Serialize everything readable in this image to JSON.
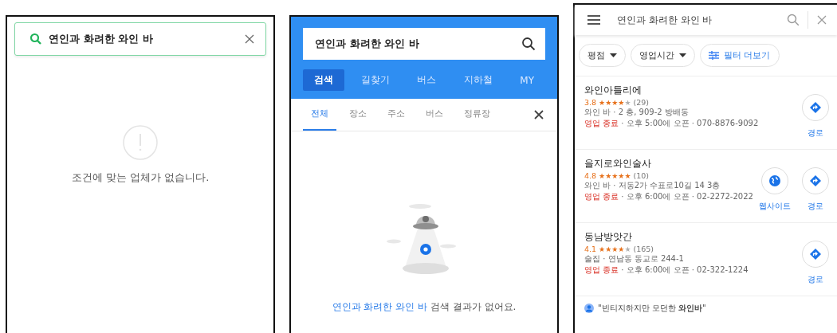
{
  "empty_result_screen": {
    "search": {
      "value": "연인과 화려한 와인 바"
    },
    "message": "조건에 맞는 업체가 없습니다."
  },
  "map_search_screen": {
    "search": {
      "value": "연인과 화려한 와인 바"
    },
    "main_tabs": [
      {
        "label": "검색",
        "selected": true
      },
      {
        "label": "길찾기",
        "selected": false
      },
      {
        "label": "버스",
        "selected": false
      },
      {
        "label": "지하철",
        "selected": false
      },
      {
        "label": "MY",
        "selected": false
      }
    ],
    "result_tabs": [
      {
        "label": "전체",
        "selected": true
      },
      {
        "label": "장소",
        "selected": false
      },
      {
        "label": "주소",
        "selected": false
      },
      {
        "label": "버스",
        "selected": false
      },
      {
        "label": "정류장",
        "selected": false
      }
    ],
    "no_result": {
      "query": "연인과 화려한 와인 바",
      "message": " 검색 결과가 없어요."
    }
  },
  "place_list_screen": {
    "search": {
      "value": "연인과 화려한 와인 바"
    },
    "filters": [
      {
        "kind": "dropdown",
        "label": "평점"
      },
      {
        "kind": "dropdown",
        "label": "영업시간"
      },
      {
        "kind": "more",
        "label": "필터 더보기"
      }
    ],
    "places": [
      {
        "name": "와인아틀리에",
        "rating": "3.8",
        "stars": 4,
        "reviews": "(29)",
        "details": "와인 바 · 2 층, 909-2 방배동",
        "status": "영업 종료",
        "hours": " · 오후 5:00에 오픈 · 070-8876-9092",
        "actions": [
          {
            "kind": "directions",
            "label": "경로"
          }
        ]
      },
      {
        "name": "을지로와인술사",
        "rating": "4.8",
        "stars": 5,
        "reviews": "(10)",
        "details": "와인 바 · 저동2가 수표로10길 14 3층",
        "status": "영업 종료",
        "hours": " · 오후 6:00에 오픈 · 02-2272-2022",
        "actions": [
          {
            "kind": "website",
            "label": "웹사이트"
          },
          {
            "kind": "directions",
            "label": "경로"
          }
        ]
      },
      {
        "name": "동남방앗간",
        "rating": "4.1",
        "stars": 4,
        "reviews": "(165)",
        "details": "술집 · 연남동 동교로 244-1",
        "status": "영업 종료",
        "hours": " · 오후 6:00에 오픈 · 02-322-1224",
        "actions": [
          {
            "kind": "directions",
            "label": "경로"
          }
        ]
      }
    ],
    "review_snippet": "\"빈티지하지만 모던한 **와인바**\""
  }
}
